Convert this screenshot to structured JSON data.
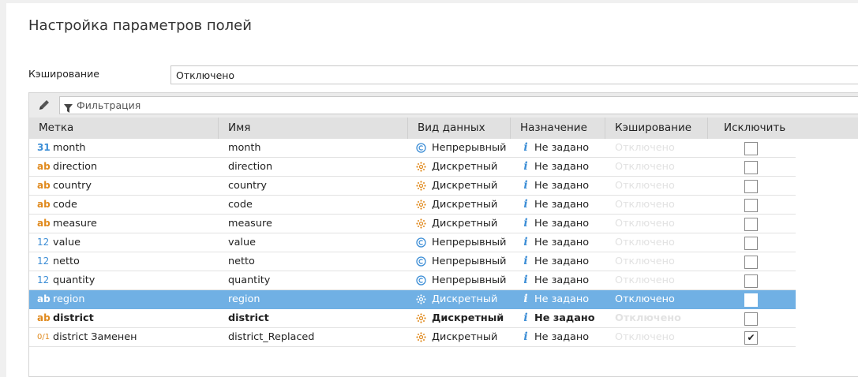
{
  "page": {
    "title": "Настройка параметров полей"
  },
  "caching": {
    "label": "Кэширование",
    "value": "Отключено"
  },
  "toolbar": {
    "filter_placeholder": "Фильтрация"
  },
  "columns": [
    "Метка",
    "Имя",
    "Вид данных",
    "Назначение",
    "Кэширование",
    "Исключить"
  ],
  "rows": [
    {
      "type_icon": "31",
      "type_kind": "date",
      "label": "month",
      "name": "month",
      "dtype": "Непрерывный",
      "dtype_kind": "continuous",
      "purpose": "Не задано",
      "cache": "Отключено",
      "excluded": ""
    },
    {
      "type_icon": "ab",
      "type_kind": "text",
      "label": "direction",
      "name": "direction",
      "dtype": "Дискретный",
      "dtype_kind": "discrete",
      "purpose": "Не задано",
      "cache": "Отключено",
      "excluded": ""
    },
    {
      "type_icon": "ab",
      "type_kind": "text",
      "label": "country",
      "name": "country",
      "dtype": "Дискретный",
      "dtype_kind": "discrete",
      "purpose": "Не задано",
      "cache": "Отключено",
      "excluded": ""
    },
    {
      "type_icon": "ab",
      "type_kind": "text",
      "label": "code",
      "name": "code",
      "dtype": "Дискретный",
      "dtype_kind": "discrete",
      "purpose": "Не задано",
      "cache": "Отключено",
      "excluded": ""
    },
    {
      "type_icon": "ab",
      "type_kind": "text",
      "label": "measure",
      "name": "measure",
      "dtype": "Дискретный",
      "dtype_kind": "discrete",
      "purpose": "Не задано",
      "cache": "Отключено",
      "excluded": ""
    },
    {
      "type_icon": "12",
      "type_kind": "num",
      "label": "value",
      "name": "value",
      "dtype": "Непрерывный",
      "dtype_kind": "continuous",
      "purpose": "Не задано",
      "cache": "Отключено",
      "excluded": ""
    },
    {
      "type_icon": "12",
      "type_kind": "num",
      "label": "netto",
      "name": "netto",
      "dtype": "Непрерывный",
      "dtype_kind": "continuous",
      "purpose": "Не задано",
      "cache": "Отключено",
      "excluded": ""
    },
    {
      "type_icon": "12",
      "type_kind": "num",
      "label": "quantity",
      "name": "quantity",
      "dtype": "Непрерывный",
      "dtype_kind": "continuous",
      "purpose": "Не задано",
      "cache": "Отключено",
      "excluded": ""
    },
    {
      "type_icon": "ab",
      "type_kind": "text",
      "label": "region",
      "name": "region",
      "dtype": "Дискретный",
      "dtype_kind": "discrete",
      "purpose": "Не задано",
      "cache": "Отключено",
      "excluded": "",
      "selected": true
    },
    {
      "type_icon": "ab",
      "type_kind": "text",
      "label": "district",
      "name": "district",
      "dtype": "Дискретный",
      "dtype_kind": "discrete",
      "purpose": "Не задано",
      "cache": "Отключено",
      "excluded": "",
      "bold": true
    },
    {
      "type_icon": "0/1",
      "type_kind": "bool",
      "label": "district Заменен",
      "name": "district_Replaced",
      "dtype": "Дискретный",
      "dtype_kind": "discrete",
      "purpose": "Не задано",
      "cache": "Отключено",
      "excluded": "✔"
    }
  ],
  "colors": {
    "selection": "#70b0e4",
    "text_type": "#e08a1e",
    "num_type": "#3d8ed6"
  }
}
